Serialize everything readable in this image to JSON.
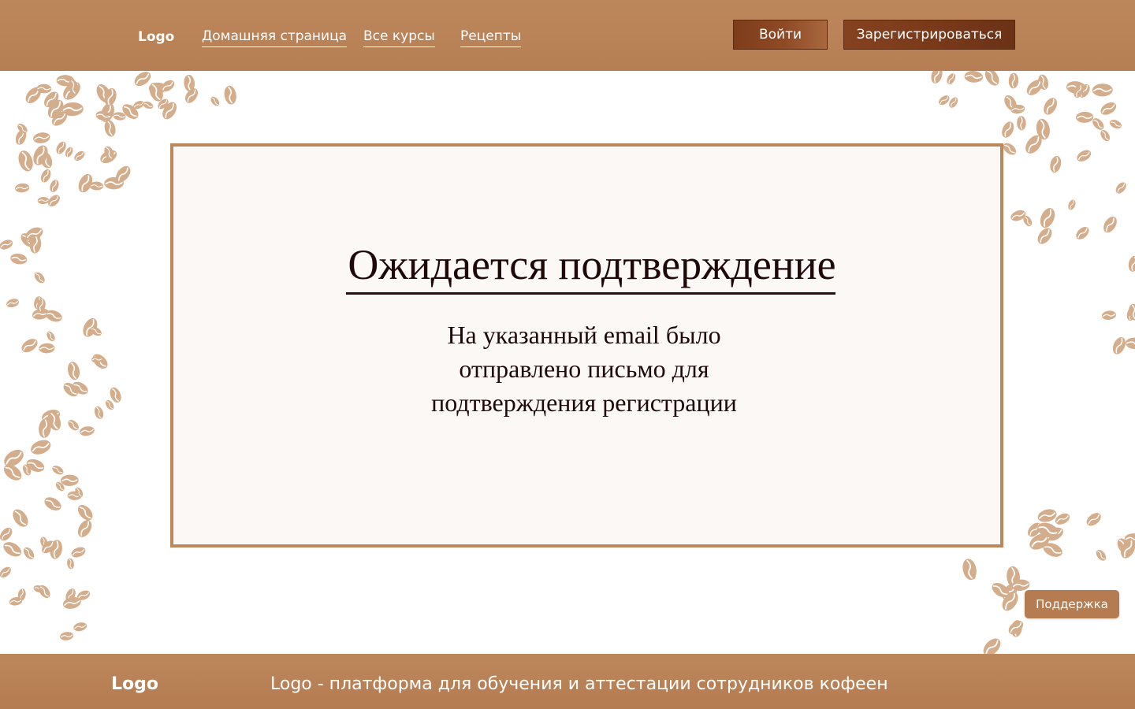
{
  "header": {
    "logo": "Logo",
    "nav": {
      "home": "Домашняя страница",
      "courses": "Все курсы",
      "recipes": "Рецепты"
    },
    "login_label": "Войти",
    "register_label": "Зарегистрироваться"
  },
  "card": {
    "title": "Ожидается подтверждение",
    "message_lines": [
      "На указанный email было",
      "отправлено письмо для",
      "подтверждения регистрации"
    ]
  },
  "support": {
    "label": "Поддержка"
  },
  "footer": {
    "logo": "Logo",
    "tagline": "Logo - платформа для обучения и аттестации сотрудников кофеен"
  },
  "colors": {
    "brand_brown": "#bd875c",
    "button_dark": "#7e3c1b",
    "card_background": "#fcf8f5",
    "bean_color": "#d4ae8c",
    "title_text": "#1e0808"
  },
  "icons": {
    "background_decor": "coffee-bean-icon"
  }
}
